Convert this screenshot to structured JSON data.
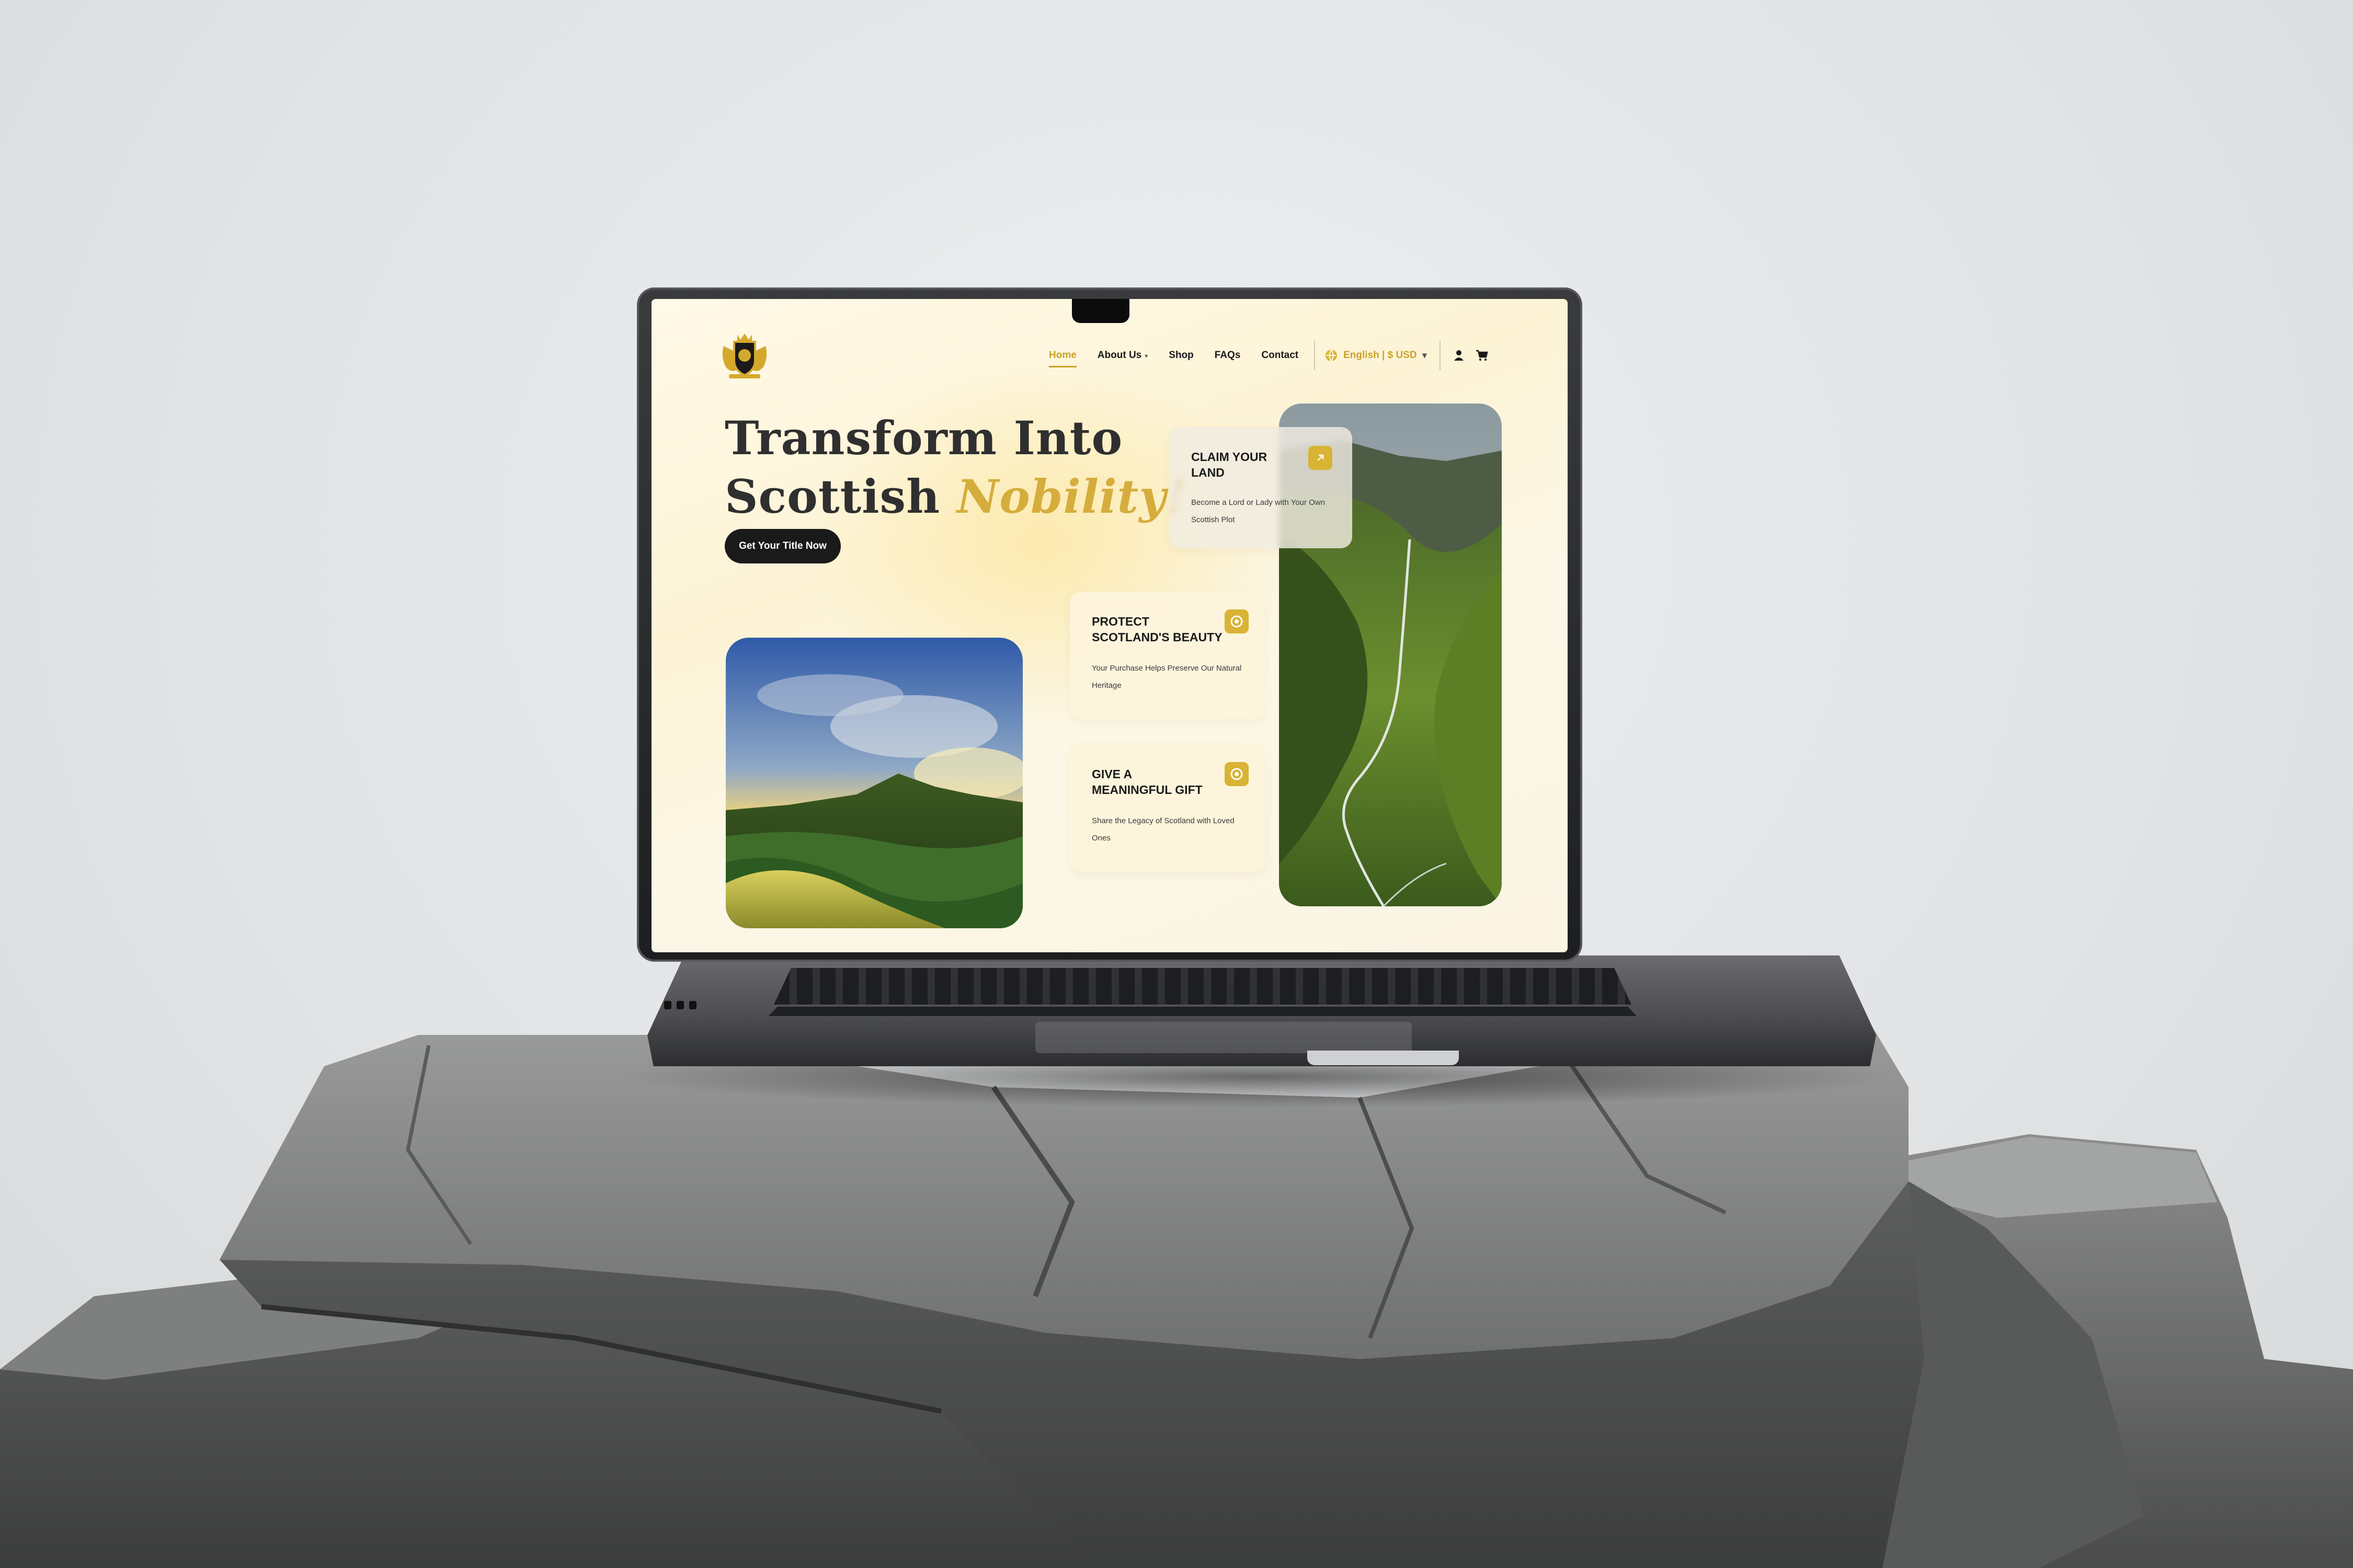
{
  "nav": {
    "home": "Home",
    "about": "About Us",
    "shop": "Shop",
    "faqs": "FAQs",
    "contact": "Contact",
    "language": "English | $ USD"
  },
  "hero": {
    "line1": "Transform Into",
    "line2": "Scottish",
    "highlight": "Nobility!",
    "cta": "Get Your Title Now"
  },
  "cards": {
    "claim": {
      "title": "CLAIM YOUR LAND",
      "text": "Become a Lord or Lady with Your Own Scottish Plot"
    },
    "protect": {
      "title": "PROTECT SCOTLAND'S BEAUTY",
      "text": "Your Purchase Helps Preserve Our Natural Heritage"
    },
    "gift": {
      "title": "GIVE A MEANINGFUL GIFT",
      "text": "Share the Legacy of Scotland with Loved Ones"
    }
  },
  "colors": {
    "accent": "#d5ad3c",
    "dark": "#1a1a1a",
    "background": "#fdf4d6"
  },
  "icons": [
    "crest-logo-icon",
    "globe-icon",
    "caret-down-icon",
    "user-icon",
    "cart-icon",
    "arrow-up-right-icon",
    "target-icon"
  ]
}
